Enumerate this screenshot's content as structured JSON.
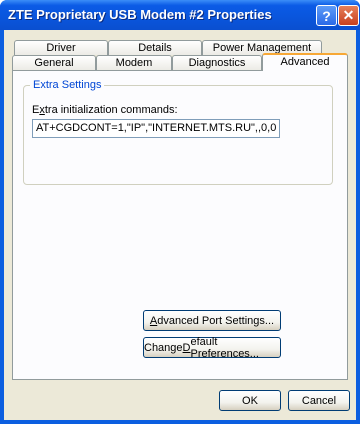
{
  "window": {
    "title": "ZTE Proprietary USB Modem #2 Properties",
    "help_glyph": "?",
    "close_glyph": "✕"
  },
  "tabs": {
    "row_back": [
      {
        "label": "Driver"
      },
      {
        "label": "Details"
      },
      {
        "label": "Power Management"
      }
    ],
    "row_front": [
      {
        "label": "General"
      },
      {
        "label": "Modem"
      },
      {
        "label": "Diagnostics"
      },
      {
        "label": "Advanced",
        "active": true
      }
    ]
  },
  "extra_settings": {
    "group_label": "Extra Settings",
    "field_label_prefix": "E",
    "field_label_underlined": "x",
    "field_label_rest": "tra initialization commands:",
    "init_commands_value": "AT+CGDCONT=1,\"IP\",\"INTERNET.MTS.RU\",,0,0"
  },
  "buttons": {
    "advanced_port_prefix": "",
    "advanced_port_underlined": "A",
    "advanced_port_rest": "dvanced Port Settings...",
    "change_defaults_prefix": "Change ",
    "change_defaults_underlined": "D",
    "change_defaults_rest": "efault Preferences...",
    "ok": "OK",
    "cancel": "Cancel"
  },
  "colors": {
    "title_bar": "#0a55dc",
    "active_tab_accent": "#f7a836",
    "group_label": "#0046d5",
    "dialog_face": "#ece9d8"
  }
}
